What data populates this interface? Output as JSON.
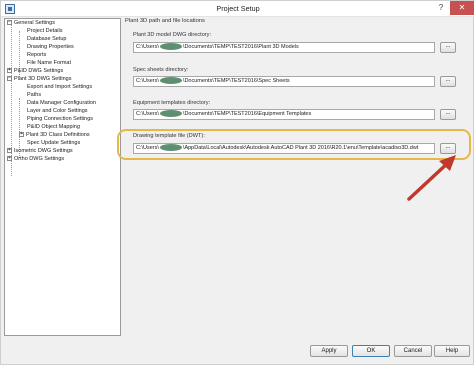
{
  "window": {
    "title": "Project Setup",
    "help_button": "?",
    "close_button": "✕"
  },
  "tree": {
    "items": [
      {
        "label": "General Settings",
        "toggle": "−"
      },
      {
        "label": "Project Details"
      },
      {
        "label": "Database Setup"
      },
      {
        "label": "Drawing Properties"
      },
      {
        "label": "Reports"
      },
      {
        "label": "File Name Format"
      },
      {
        "label": "P&ID DWG Settings",
        "toggle": "+"
      },
      {
        "label": "Plant 3D DWG Settings",
        "toggle": "−"
      },
      {
        "label": "Export and Import Settings"
      },
      {
        "label": "Paths"
      },
      {
        "label": "Data Manager Configuration"
      },
      {
        "label": "Layer and Color Settings"
      },
      {
        "label": "Piping Connection Settings"
      },
      {
        "label": "P&ID Object Mapping"
      },
      {
        "label": "Plant 3D Class Definitions",
        "toggle": "+"
      },
      {
        "label": "Spec Update Settings"
      },
      {
        "label": "Isometric DWG Settings",
        "toggle": "+"
      },
      {
        "label": "Ortho DWG Settings",
        "toggle": "+"
      }
    ]
  },
  "panel": {
    "section_title": "Plant 3D path and file locations",
    "fields": [
      {
        "label": "Plant 3D model DWG directory:",
        "prefix": "C:\\Users\\",
        "suffix": "\\Documents\\TEMP\\TEST2016\\Plant 3D Models"
      },
      {
        "label": "Spec sheets directory:",
        "prefix": "C:\\Users\\",
        "suffix": "\\Documents\\TEMP\\TEST2016\\Spec Sheets"
      },
      {
        "label": "Equipment templates directory:",
        "prefix": "C:\\Users\\",
        "suffix": "\\Documents\\TEMP\\TEST2016\\Equipment Templates"
      },
      {
        "label": "Drawing template file (DWT):",
        "prefix": "C:\\Users\\",
        "suffix": "\\AppData\\Local\\Autodesk\\Autodesk AutoCAD Plant 3D 2016\\R20.1\\enu\\Template\\acadiso3D.dwt"
      }
    ],
    "browse_label": "..."
  },
  "footer": {
    "apply": "Apply",
    "ok": "OK",
    "cancel": "Cancel",
    "help": "Help"
  },
  "colors": {
    "highlight": "#e6b84a",
    "arrow": "#c0392b",
    "redaction": "#5e8f72"
  }
}
